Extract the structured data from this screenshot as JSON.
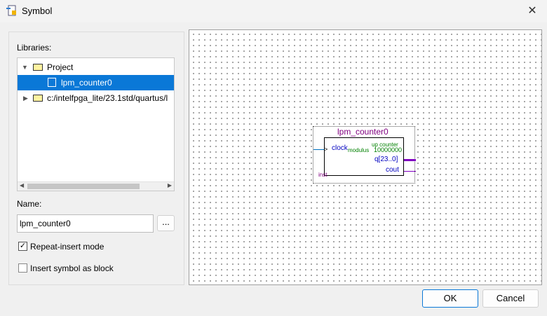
{
  "window": {
    "title": "Symbol"
  },
  "libraries": {
    "label": "Libraries:",
    "tree": [
      {
        "label": "Project",
        "expanded": true
      },
      {
        "label": "lpm_counter0",
        "selected": true
      },
      {
        "label": "c:/intelfpga_lite/23.1std/quartus/l",
        "expanded": false
      }
    ]
  },
  "name": {
    "label": "Name:",
    "value": "lpm_counter0",
    "browse_label": "..."
  },
  "options": {
    "repeat_insert": {
      "label": "Repeat-insert mode",
      "checked": true
    },
    "as_block": {
      "label": "Insert symbol as block",
      "checked": false
    }
  },
  "symbol": {
    "title": "lpm_counter0",
    "clock": "clock",
    "modulus_label": "modulus",
    "modulus_value": "10000000",
    "type": "up counter",
    "q": "q[23..0]",
    "cout": "cout",
    "inst": "inst"
  },
  "buttons": {
    "ok": "OK",
    "cancel": "Cancel"
  },
  "colors": {
    "accent": "#0a78d7",
    "symbol_title": "#800080",
    "port": "#0000c0",
    "param": "#008000"
  }
}
